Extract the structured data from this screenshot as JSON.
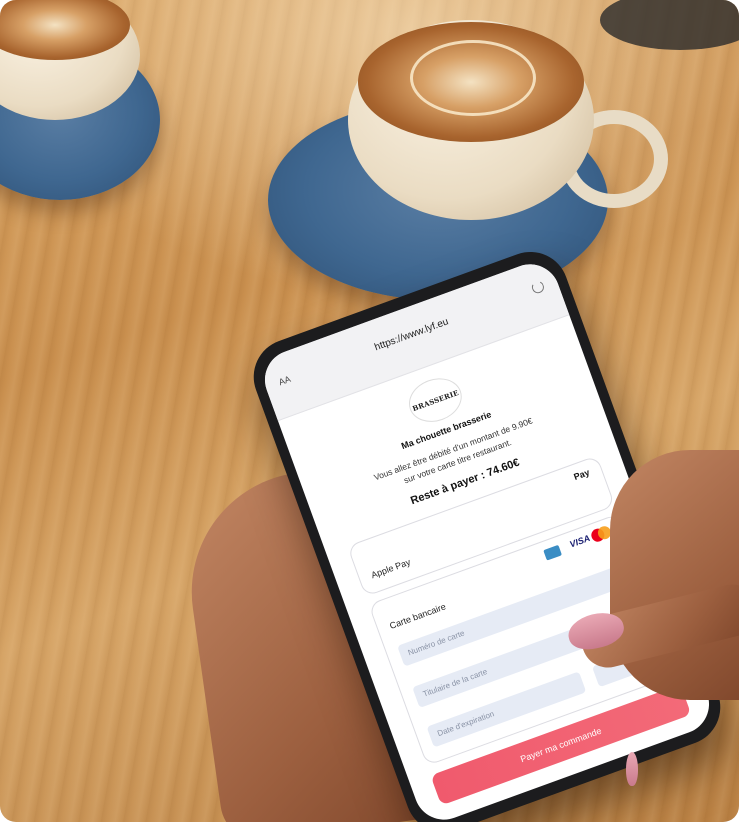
{
  "browser": {
    "text_size_label": "AA",
    "url": "https://www.lyf.eu"
  },
  "merchant": {
    "logo_text": "BRASSERIE",
    "name": "Ma chouette brasserie"
  },
  "payment": {
    "info_line_1": "Vous allez être débité d'un montant de 9.90€",
    "info_line_2": "sur votre carte titre restaurant.",
    "remaining": "Reste à payer : 74.60€"
  },
  "apple_pay": {
    "logo": " Pay",
    "label": "Apple Pay"
  },
  "card": {
    "label": "Carte bancaire",
    "visa": "VISA",
    "number_placeholder": "Numéro de carte",
    "holder_placeholder": "Titulaire de la carte",
    "expiry_placeholder": "Date d'expiration"
  },
  "pay_button": {
    "label": "Payer ma commande"
  },
  "colors": {
    "pay_button": "#f05a6d",
    "field_bg": "#e6ebf5",
    "saucer": "#3f6790"
  }
}
